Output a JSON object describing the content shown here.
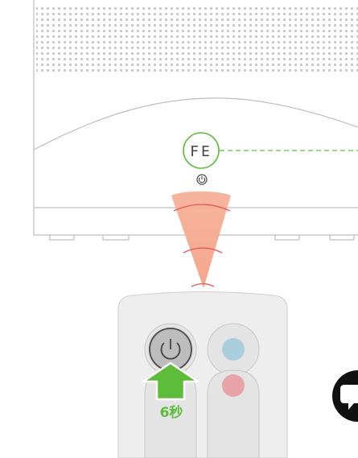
{
  "device": {
    "display_code": "FE",
    "power_icon": "power-icon"
  },
  "remote": {
    "hold_duration_label": "6秒",
    "buttons": [
      {
        "name": "power-button",
        "icon": "power-icon"
      },
      {
        "name": "blue-button",
        "color": "#a9cfdf"
      },
      {
        "name": "lower-left-button"
      },
      {
        "name": "red-button",
        "color": "#e8a3a8"
      }
    ]
  },
  "colors": {
    "signal_beam": "#f4a488",
    "signal_arc": "#e8555a",
    "display_highlight": "#5dbd3a",
    "press_arrow": "#5dbd3a",
    "remote_body": "#eeeeee"
  },
  "side_icon": "chat-icon"
}
